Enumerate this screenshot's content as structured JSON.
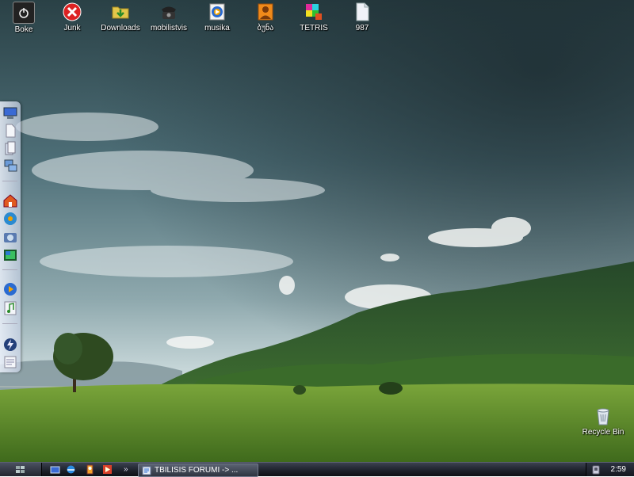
{
  "desktop": {
    "icons": [
      {
        "label": "Boke",
        "icon": "power-icon"
      },
      {
        "label": "Junk",
        "icon": "close-icon"
      },
      {
        "label": "Downloads",
        "icon": "folder-download-icon"
      },
      {
        "label": "mobilistvis",
        "icon": "telephone-icon"
      },
      {
        "label": "musika",
        "icon": "media-player-icon"
      },
      {
        "label": "ბუნა",
        "icon": "user-icon"
      },
      {
        "label": "TETRIS",
        "icon": "tetris-blocks-icon"
      },
      {
        "label": "987",
        "icon": "file-icon"
      }
    ],
    "recycle_bin": {
      "label": "Recycle Bin",
      "icon": "recycle-bin-icon"
    }
  },
  "dock": {
    "items": [
      "computer-icon",
      "document-icon",
      "documents-icon",
      "network-icon",
      "home-icon",
      "music-disc-icon",
      "camera-icon",
      "video-icon",
      "media-player-icon",
      "music-note-icon",
      "flash-icon",
      "notepad-icon"
    ]
  },
  "taskbar": {
    "quick_launch": [
      "desktop-window-icon",
      "browser-icon",
      "app-icon",
      "media-icon"
    ],
    "more_label": "»",
    "task_label": "TBILISIS FORUMI -> ...",
    "clock": "2:59"
  },
  "colors": {
    "sky_top": "#25393f",
    "sky_mid": "#6d8e96",
    "horizon": "#b9ccd1",
    "hills": "#2f5e2a",
    "grass": "#5e8f2c",
    "taskbar": "#1c2029"
  }
}
